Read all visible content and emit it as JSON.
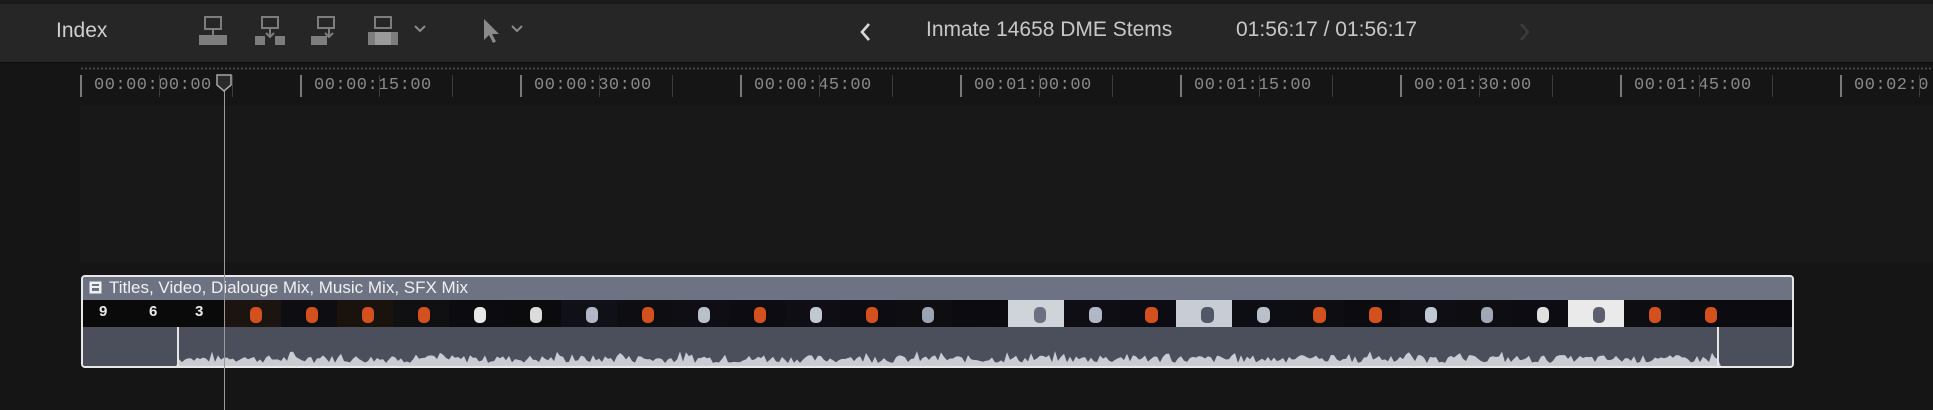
{
  "toolbar": {
    "index_label": "Index",
    "edit_tools": [
      {
        "name": "connect-clip-icon"
      },
      {
        "name": "insert-clip-icon"
      },
      {
        "name": "append-clip-icon"
      },
      {
        "name": "overwrite-clip-icon"
      }
    ],
    "select_tool_icon": "arrow-pointer-icon",
    "back_icon": "chevron-left-icon",
    "forward_icon": "chevron-right-icon",
    "project_title": "Inmate 14658 DME Stems",
    "timecode": "01:56:17 / 01:56:17"
  },
  "ruler": {
    "labels": [
      "00:00:00:00",
      "00:00:15:00",
      "00:00:30:00",
      "00:00:45:00",
      "00:01:00:00",
      "00:01:15:00",
      "00:01:30:00",
      "00:01:45:00",
      "00:02:0"
    ]
  },
  "clip": {
    "title": "Titles, Video, Dialouge Mix, Music Mix, SFX Mix",
    "countdown": [
      "9",
      "6",
      "3"
    ]
  },
  "colors": {
    "toolbar_bg": "#262626",
    "timeline_bg": "#151515",
    "clip_header": "#6e7384",
    "clip_border": "#e8e8e8",
    "audio_wave": "#c9ccd3",
    "frame_orange": "#d2511c"
  }
}
